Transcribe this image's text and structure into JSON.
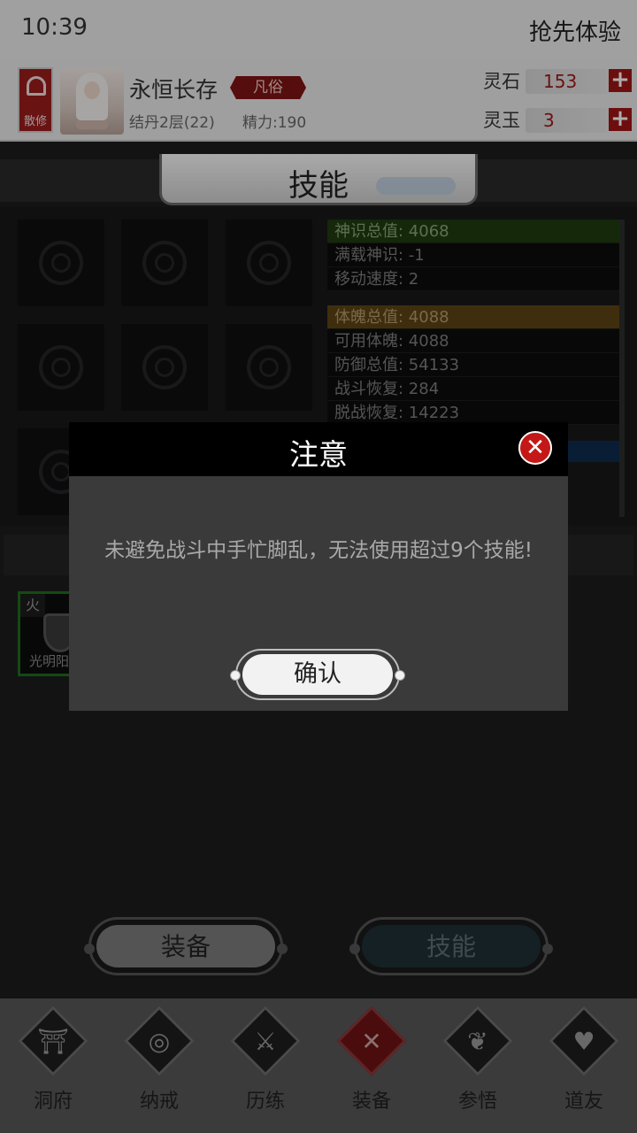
{
  "status_bar": {
    "time": "10:39",
    "app_label": "抢先体验"
  },
  "player": {
    "sect": "散修",
    "name": "永恒长存",
    "rank": "凡俗",
    "realm": "结丹2层(22)",
    "stamina": "精力:190"
  },
  "currencies": [
    {
      "label": "灵石",
      "value": "153"
    },
    {
      "label": "灵玉",
      "value": "3"
    }
  ],
  "panel_title": "技能",
  "stats": {
    "spirit": [
      "神识总值: 4068",
      "满载神识: -1",
      "移动速度: 2"
    ],
    "body": [
      "体魄总值: 4088",
      "可用体魄: 4088",
      "防御总值: 54133",
      "战斗恢复: 284",
      "脱战恢复: 14223"
    ]
  },
  "equipped": {
    "element": "火",
    "name": "光明阳"
  },
  "tabs": {
    "equip_label": "装备",
    "skill_label": "技能"
  },
  "nav": [
    {
      "label": "洞府",
      "icon": "gate-icon",
      "glyph": "⛩"
    },
    {
      "label": "纳戒",
      "icon": "ring-icon",
      "glyph": "◎"
    },
    {
      "label": "历练",
      "icon": "crossed-swords-icon",
      "glyph": "⚔"
    },
    {
      "label": "装备",
      "icon": "equipment-icon",
      "glyph": "✕"
    },
    {
      "label": "参悟",
      "icon": "book-icon",
      "glyph": "❦"
    },
    {
      "label": "道友",
      "icon": "handshake-icon",
      "glyph": "♥"
    }
  ],
  "dialog": {
    "title": "注意",
    "message": "未避免战斗中手忙脚乱，无法使用超过9个技能!",
    "confirm_label": "确认"
  },
  "colors": {
    "accent_red": "#a11515",
    "active_equip_border": "#1e6e1e"
  }
}
